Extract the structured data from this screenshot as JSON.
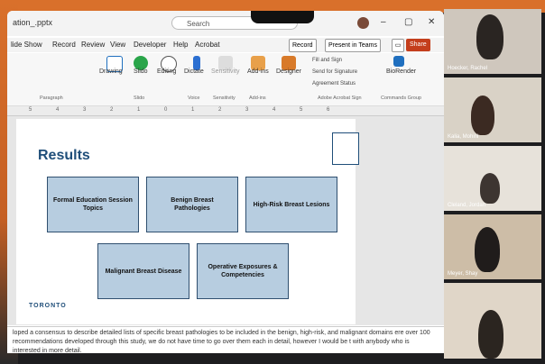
{
  "window": {
    "filename": "ation_.pptx",
    "search_placeholder": "Search",
    "controls": [
      "–",
      "▢",
      "✕"
    ]
  },
  "menubar": {
    "items": [
      "lide Show",
      "Record",
      "Review",
      "View",
      "Developer",
      "Help",
      "Acrobat"
    ],
    "record_btn": "Record",
    "present_btn": "Present in Teams",
    "share_btn": "Share"
  },
  "ribbon": {
    "buttons": [
      "Drawing",
      "Slido",
      "Editing",
      "Dictate",
      "Sensitivity",
      "Add-ins",
      "Designer"
    ],
    "acrobat": [
      "Fill and Sign",
      "Send for Signature",
      "Agreement Status"
    ],
    "biorender": "BioRender",
    "groups": [
      "Paragraph",
      "Slido",
      "Voice",
      "Sensitivity",
      "Add-ins",
      "Adobe Acrobat Sign",
      "Commands Group"
    ]
  },
  "ruler": [
    "5",
    "4",
    "3",
    "2",
    "1",
    "0",
    "1",
    "2",
    "3",
    "4",
    "5",
    "6"
  ],
  "slide": {
    "title": "Results",
    "boxes": [
      "Formal Education Session Topics",
      "Benign Breast Pathologies",
      "High-Risk Breast Lesions",
      "Malignant Breast Disease",
      "Operative Exposures & Competencies"
    ],
    "logo_text": "TORONTO"
  },
  "notes": "loped a consensus to describe detailed lists of specific breast pathologies to be included in the benign, high-risk, and malignant domains ere over 100 recommendations developed through this study, we do not have time to go over them each in detail, however I would be t with anybody who is interested in more detail.",
  "participants": [
    "Hoecker, Rachel",
    "Kalia, Mohini",
    "Cleland, Jordan",
    "Meyer, Shay",
    ""
  ]
}
